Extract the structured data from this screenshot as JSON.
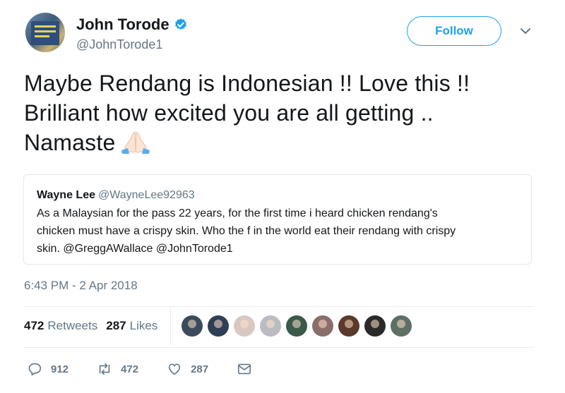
{
  "author": {
    "name": "John Torode",
    "handle": "@JohnTorode1",
    "verified": true
  },
  "follow_label": "Follow",
  "tweet": {
    "lines": [
      "Maybe Rendang is Indonesian !!   Love this !!",
      "Brilliant how excited you are all getting ..",
      "Namaste"
    ],
    "emoji": "folded-hands-emoji"
  },
  "quote": {
    "name": "Wayne Lee",
    "handle": "@WayneLee92963",
    "lines": [
      "As a Malaysian for the pass 22 years, for the first time i heard chicken rendang's",
      "chicken must have a crispy skin. Who the f in the world eat their rendang with crispy",
      "skin. @GreggAWallace @JohnTorode1"
    ]
  },
  "timestamp": "6:43 PM - 2 Apr 2018",
  "stats": {
    "retweets_count": "472",
    "retweets_label": "Retweets",
    "likes_count": "287",
    "likes_label": "Likes"
  },
  "liker_avatars": [
    "#3b4a5c",
    "#2d3e55",
    "#d9c8c2",
    "#b9bcc0",
    "#3a5a4a",
    "#8a6e6a",
    "#5a3a2a",
    "#2a2a2a",
    "#5f6f66"
  ],
  "actions": {
    "reply_count": "912",
    "retweet_count": "472",
    "like_count": "287"
  },
  "colors": {
    "accent": "#1da1f2",
    "secondary_text": "#657786",
    "primary_text": "#14171a",
    "border": "#e1e8ed"
  }
}
